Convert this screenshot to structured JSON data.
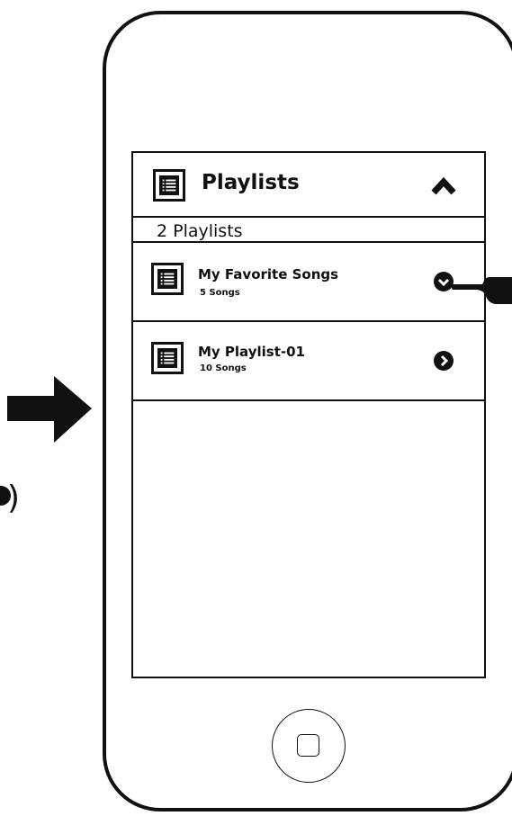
{
  "header": {
    "title": "Playlists",
    "icon": "playlist-icon",
    "collapse_icon": "chevron-up-icon"
  },
  "summary": {
    "count_label": "2 Playlists"
  },
  "playlists": [
    {
      "name": "My Favorite Songs",
      "songs": "5 Songs",
      "action_icon": "chevron-down-circle-icon"
    },
    {
      "name": "My Playlist-01",
      "songs": "10 Songs",
      "action_icon": "chevron-right-circle-icon"
    }
  ],
  "device": {
    "home_button_icon": "home-square-icon"
  },
  "colors": {
    "ink": "#111111",
    "background": "#ffffff"
  }
}
